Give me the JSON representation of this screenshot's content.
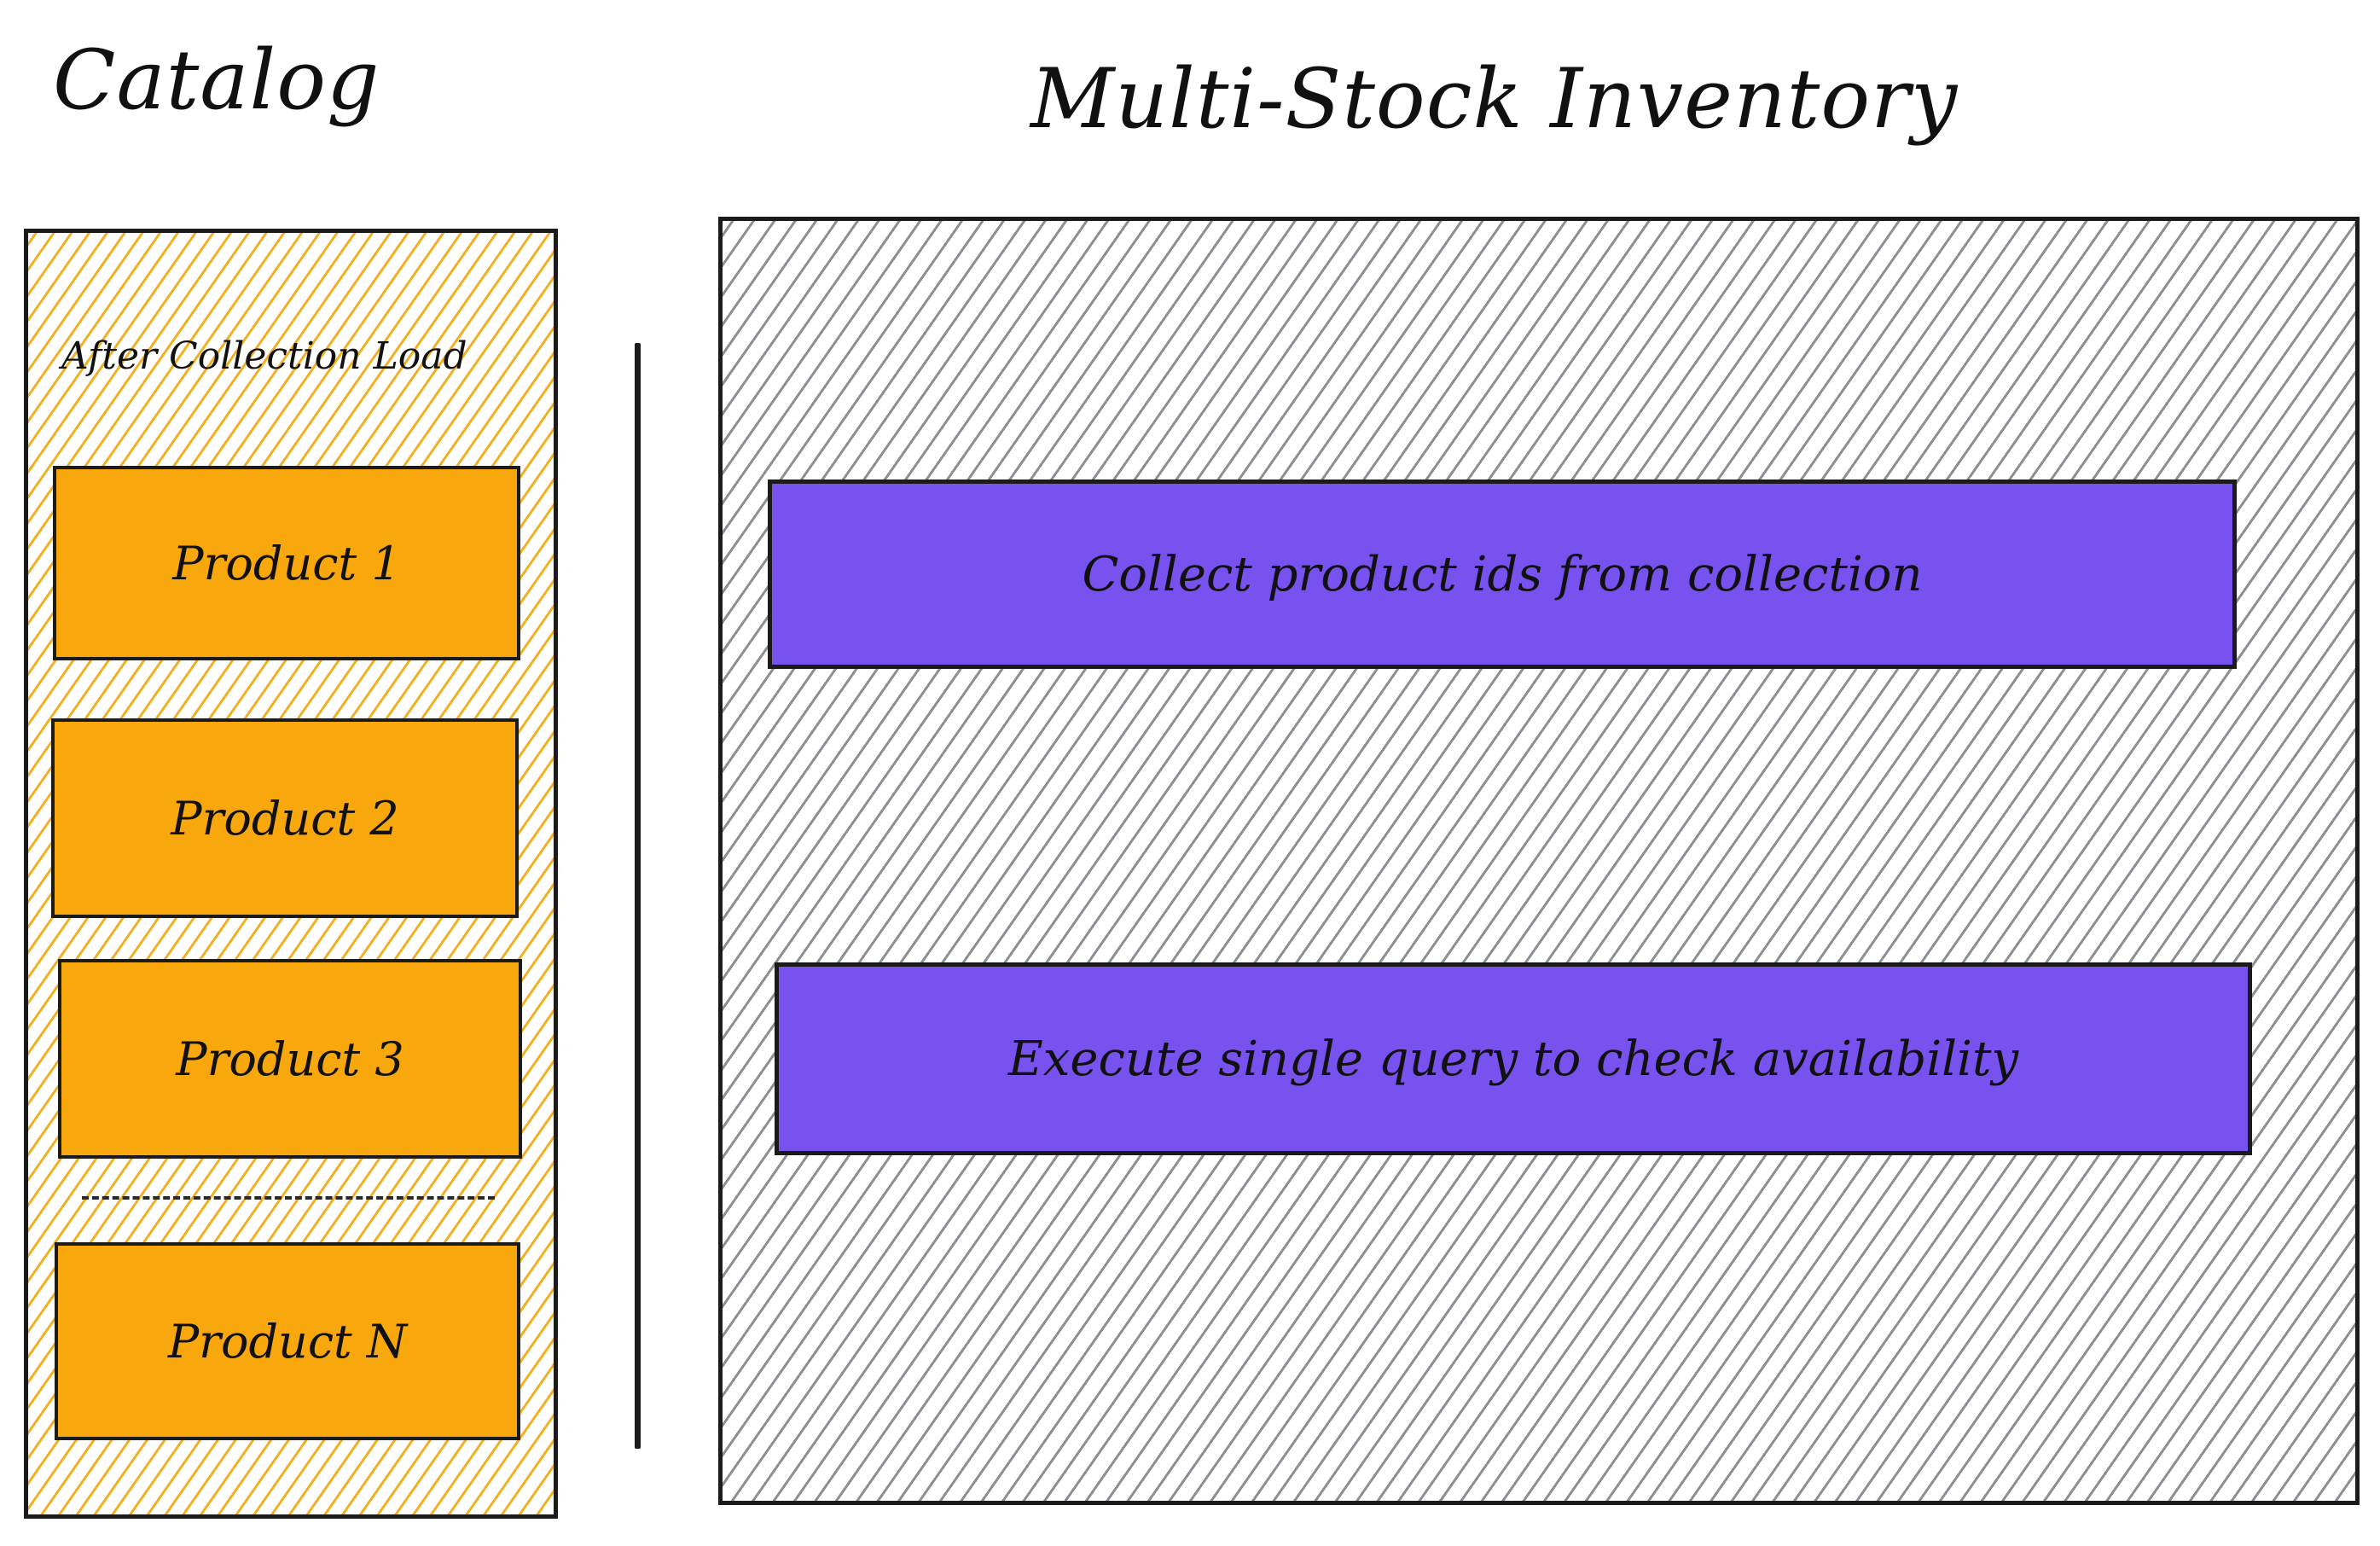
{
  "catalog": {
    "title": "Catalog",
    "caption": "After Collection Load",
    "products": [
      "Product 1",
      "Product 2",
      "Product 3",
      "Product N"
    ],
    "panel_color": "#f2b125",
    "product_color": "#f8a80c"
  },
  "inventory": {
    "title": "Multi-Stock Inventory",
    "steps": [
      "Collect product ids from collection",
      "Execute single query to check availability"
    ],
    "step_color": "#7752ef",
    "panel_hatch_color": "#8d8f94"
  }
}
